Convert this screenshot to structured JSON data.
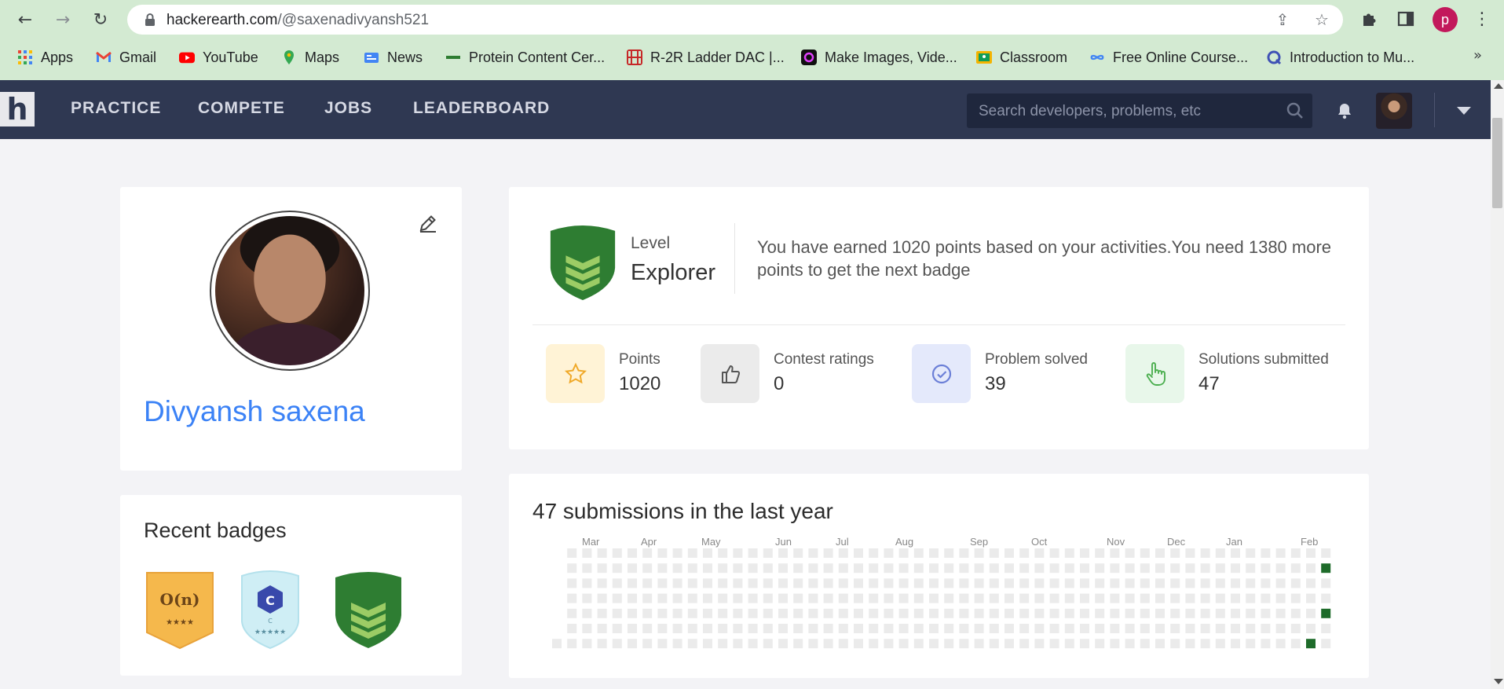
{
  "browser": {
    "url_domain": "hackerearth.com",
    "url_path": "/@saxenadivyansh521",
    "profile_initial": "p",
    "bookmarks": [
      {
        "label": "Apps",
        "icon": "apps-grid-icon"
      },
      {
        "label": "Gmail",
        "icon": "gmail-icon"
      },
      {
        "label": "YouTube",
        "icon": "youtube-icon"
      },
      {
        "label": "Maps",
        "icon": "maps-icon"
      },
      {
        "label": "News",
        "icon": "news-icon"
      },
      {
        "label": "Protein Content Cer...",
        "icon": "site-icon"
      },
      {
        "label": "R-2R Ladder DAC |...",
        "icon": "site-icon"
      },
      {
        "label": "Make Images, Vide...",
        "icon": "site-icon"
      },
      {
        "label": "Classroom",
        "icon": "classroom-icon"
      },
      {
        "label": "Free Online Course...",
        "icon": "site-icon"
      },
      {
        "label": "Introduction to Mu...",
        "icon": "site-icon"
      }
    ],
    "more_label": "»"
  },
  "site": {
    "logo_letter": "h",
    "menu": [
      "PRACTICE",
      "COMPETE",
      "JOBS",
      "LEADERBOARD"
    ],
    "search_placeholder": "Search developers, problems, etc"
  },
  "profile": {
    "name": "Divyansh saxena"
  },
  "badges": {
    "title": "Recent badges",
    "items": [
      {
        "text": "O(n)",
        "stars": "★★★★",
        "color": "#f5b84c"
      },
      {
        "text": "C",
        "sub": "C",
        "stars": "★★★★★",
        "color": "#cfeef5"
      },
      {
        "text": "",
        "color": "#2e7d32"
      }
    ]
  },
  "level": {
    "label": "Level",
    "value": "Explorer",
    "message": "You have earned 1020 points based on your activities.You need 1380 more points to get the next badge"
  },
  "stats": [
    {
      "label": "Points",
      "value": "1020",
      "icon": "star-icon",
      "bg": "#fff3d6"
    },
    {
      "label": "Contest ratings",
      "value": "0",
      "icon": "thumbs-up-icon",
      "bg": "#ebebeb"
    },
    {
      "label": "Problem solved",
      "value": "39",
      "icon": "check-circle-icon",
      "bg": "#e4e9fb"
    },
    {
      "label": "Solutions submitted",
      "value": "47",
      "icon": "hand-pointer-icon",
      "bg": "#e8f7ea"
    }
  ],
  "submissions": {
    "title": "47 submissions in the last year",
    "months": [
      "Mar",
      "Apr",
      "May",
      "Jun",
      "Jul",
      "Aug",
      "Sep",
      "Oct",
      "Nov",
      "Dec",
      "Jan",
      "Feb"
    ],
    "active_cells": [
      {
        "week": 51,
        "day": 1
      },
      {
        "week": 51,
        "day": 4
      },
      {
        "week": 50,
        "day": 6
      }
    ]
  }
}
